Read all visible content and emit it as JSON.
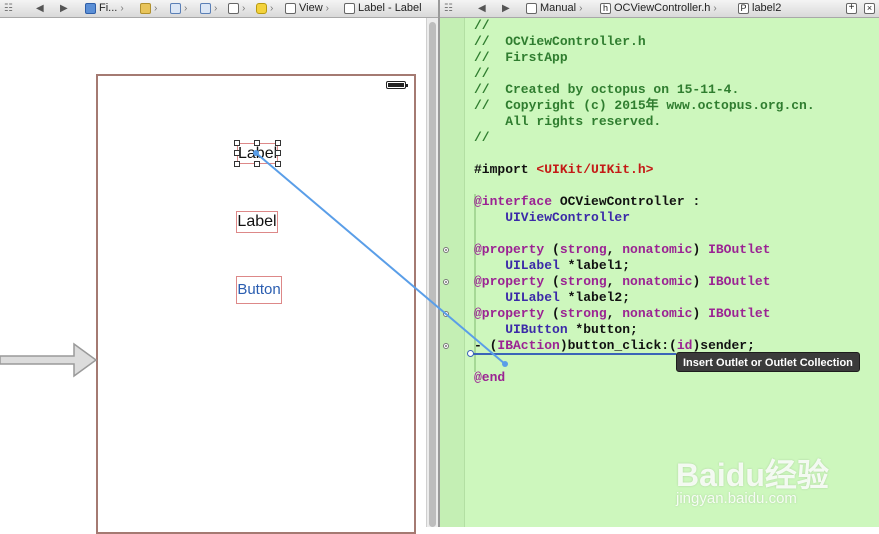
{
  "left_bar": {
    "items": [
      "Fi...",
      "View",
      "Label - Label"
    ]
  },
  "right_bar": {
    "items": [
      "Manual",
      "OCViewController.h",
      "label2"
    ]
  },
  "canvas": {
    "label1_text": "Label",
    "label2_text": "Label",
    "button_text": "Button"
  },
  "code": {
    "lines": [
      {
        "parts": [
          {
            "t": "//",
            "c": "cm"
          }
        ]
      },
      {
        "parts": [
          {
            "t": "//  OCViewController.h",
            "c": "cm"
          }
        ]
      },
      {
        "parts": [
          {
            "t": "//  FirstApp",
            "c": "cm"
          }
        ]
      },
      {
        "parts": [
          {
            "t": "//",
            "c": "cm"
          }
        ]
      },
      {
        "parts": [
          {
            "t": "//  Created by octopus on 15-11-4.",
            "c": "cm"
          }
        ]
      },
      {
        "parts": [
          {
            "t": "//  Copyright (c) 2015年 www.octopus.org.cn.",
            "c": "cm"
          }
        ]
      },
      {
        "parts": [
          {
            "t": "    All rights reserved.",
            "c": "cm"
          }
        ]
      },
      {
        "parts": [
          {
            "t": "//",
            "c": "cm"
          }
        ]
      },
      {
        "parts": [
          {
            "t": "",
            "c": ""
          }
        ]
      },
      {
        "parts": [
          {
            "t": "#import ",
            "c": ""
          },
          {
            "t": "<UIKit/UIKit.h>",
            "c": "st"
          }
        ]
      },
      {
        "parts": [
          {
            "t": "",
            "c": ""
          }
        ]
      },
      {
        "parts": [
          {
            "t": "@interface",
            "c": "kw"
          },
          {
            "t": " OCViewController :",
            "c": ""
          }
        ]
      },
      {
        "parts": [
          {
            "t": "    UIViewController",
            "c": "ty"
          }
        ]
      },
      {
        "parts": [
          {
            "t": "",
            "c": ""
          }
        ]
      },
      {
        "parts": [
          {
            "t": "@property",
            "c": "kw"
          },
          {
            "t": " (",
            "c": ""
          },
          {
            "t": "strong",
            "c": "kw"
          },
          {
            "t": ", ",
            "c": ""
          },
          {
            "t": "nonatomic",
            "c": "kw"
          },
          {
            "t": ") ",
            "c": ""
          },
          {
            "t": "IBOutlet",
            "c": "kw"
          }
        ]
      },
      {
        "parts": [
          {
            "t": "    UILabel",
            "c": "ty"
          },
          {
            "t": " *label1;",
            "c": ""
          }
        ]
      },
      {
        "parts": [
          {
            "t": "@property",
            "c": "kw"
          },
          {
            "t": " (",
            "c": ""
          },
          {
            "t": "strong",
            "c": "kw"
          },
          {
            "t": ", ",
            "c": ""
          },
          {
            "t": "nonatomic",
            "c": "kw"
          },
          {
            "t": ") ",
            "c": ""
          },
          {
            "t": "IBOutlet",
            "c": "kw"
          }
        ]
      },
      {
        "parts": [
          {
            "t": "    UILabel",
            "c": "ty"
          },
          {
            "t": " *label2;",
            "c": ""
          }
        ]
      },
      {
        "parts": [
          {
            "t": "@property",
            "c": "kw"
          },
          {
            "t": " (",
            "c": ""
          },
          {
            "t": "strong",
            "c": "kw"
          },
          {
            "t": ", ",
            "c": ""
          },
          {
            "t": "nonatomic",
            "c": "kw"
          },
          {
            "t": ") ",
            "c": ""
          },
          {
            "t": "IBOutlet",
            "c": "kw"
          }
        ]
      },
      {
        "parts": [
          {
            "t": "    UIButton",
            "c": "ty"
          },
          {
            "t": " *button;",
            "c": ""
          }
        ]
      },
      {
        "parts": [
          {
            "t": "- (",
            "c": ""
          },
          {
            "t": "IBAction",
            "c": "kw"
          },
          {
            "t": ")button_click:(",
            "c": ""
          },
          {
            "t": "id",
            "c": "kw"
          },
          {
            "t": ")sender;",
            "c": ""
          }
        ]
      },
      {
        "parts": [
          {
            "t": "",
            "c": ""
          }
        ]
      },
      {
        "parts": [
          {
            "t": "@end",
            "c": "kw"
          }
        ]
      }
    ]
  },
  "tooltip": "Insert Outlet or Outlet Collection",
  "watermark": {
    "brand": "Baidu经验",
    "url": "jingyan.baidu.com"
  }
}
